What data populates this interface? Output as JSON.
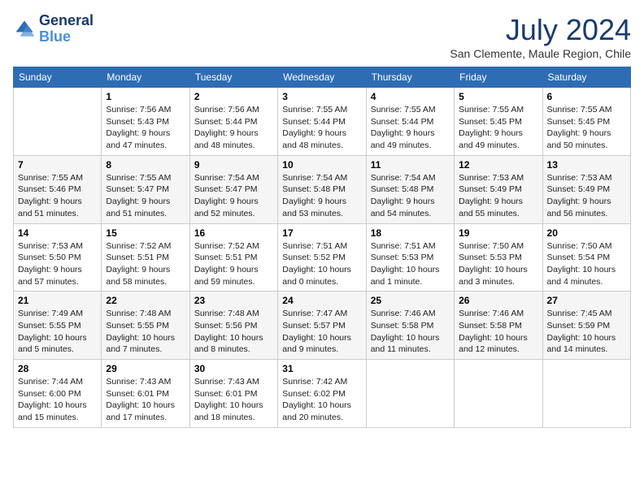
{
  "logo": {
    "line1": "General",
    "line2": "Blue"
  },
  "title": "July 2024",
  "subtitle": "San Clemente, Maule Region, Chile",
  "headers": [
    "Sunday",
    "Monday",
    "Tuesday",
    "Wednesday",
    "Thursday",
    "Friday",
    "Saturday"
  ],
  "weeks": [
    [
      {
        "day": "",
        "info": ""
      },
      {
        "day": "1",
        "info": "Sunrise: 7:56 AM\nSunset: 5:43 PM\nDaylight: 9 hours\nand 47 minutes."
      },
      {
        "day": "2",
        "info": "Sunrise: 7:56 AM\nSunset: 5:44 PM\nDaylight: 9 hours\nand 48 minutes."
      },
      {
        "day": "3",
        "info": "Sunrise: 7:55 AM\nSunset: 5:44 PM\nDaylight: 9 hours\nand 48 minutes."
      },
      {
        "day": "4",
        "info": "Sunrise: 7:55 AM\nSunset: 5:44 PM\nDaylight: 9 hours\nand 49 minutes."
      },
      {
        "day": "5",
        "info": "Sunrise: 7:55 AM\nSunset: 5:45 PM\nDaylight: 9 hours\nand 49 minutes."
      },
      {
        "day": "6",
        "info": "Sunrise: 7:55 AM\nSunset: 5:45 PM\nDaylight: 9 hours\nand 50 minutes."
      }
    ],
    [
      {
        "day": "7",
        "info": "Sunrise: 7:55 AM\nSunset: 5:46 PM\nDaylight: 9 hours\nand 51 minutes."
      },
      {
        "day": "8",
        "info": "Sunrise: 7:55 AM\nSunset: 5:47 PM\nDaylight: 9 hours\nand 51 minutes."
      },
      {
        "day": "9",
        "info": "Sunrise: 7:54 AM\nSunset: 5:47 PM\nDaylight: 9 hours\nand 52 minutes."
      },
      {
        "day": "10",
        "info": "Sunrise: 7:54 AM\nSunset: 5:48 PM\nDaylight: 9 hours\nand 53 minutes."
      },
      {
        "day": "11",
        "info": "Sunrise: 7:54 AM\nSunset: 5:48 PM\nDaylight: 9 hours\nand 54 minutes."
      },
      {
        "day": "12",
        "info": "Sunrise: 7:53 AM\nSunset: 5:49 PM\nDaylight: 9 hours\nand 55 minutes."
      },
      {
        "day": "13",
        "info": "Sunrise: 7:53 AM\nSunset: 5:49 PM\nDaylight: 9 hours\nand 56 minutes."
      }
    ],
    [
      {
        "day": "14",
        "info": "Sunrise: 7:53 AM\nSunset: 5:50 PM\nDaylight: 9 hours\nand 57 minutes."
      },
      {
        "day": "15",
        "info": "Sunrise: 7:52 AM\nSunset: 5:51 PM\nDaylight: 9 hours\nand 58 minutes."
      },
      {
        "day": "16",
        "info": "Sunrise: 7:52 AM\nSunset: 5:51 PM\nDaylight: 9 hours\nand 59 minutes."
      },
      {
        "day": "17",
        "info": "Sunrise: 7:51 AM\nSunset: 5:52 PM\nDaylight: 10 hours\nand 0 minutes."
      },
      {
        "day": "18",
        "info": "Sunrise: 7:51 AM\nSunset: 5:53 PM\nDaylight: 10 hours\nand 1 minute."
      },
      {
        "day": "19",
        "info": "Sunrise: 7:50 AM\nSunset: 5:53 PM\nDaylight: 10 hours\nand 3 minutes."
      },
      {
        "day": "20",
        "info": "Sunrise: 7:50 AM\nSunset: 5:54 PM\nDaylight: 10 hours\nand 4 minutes."
      }
    ],
    [
      {
        "day": "21",
        "info": "Sunrise: 7:49 AM\nSunset: 5:55 PM\nDaylight: 10 hours\nand 5 minutes."
      },
      {
        "day": "22",
        "info": "Sunrise: 7:48 AM\nSunset: 5:55 PM\nDaylight: 10 hours\nand 7 minutes."
      },
      {
        "day": "23",
        "info": "Sunrise: 7:48 AM\nSunset: 5:56 PM\nDaylight: 10 hours\nand 8 minutes."
      },
      {
        "day": "24",
        "info": "Sunrise: 7:47 AM\nSunset: 5:57 PM\nDaylight: 10 hours\nand 9 minutes."
      },
      {
        "day": "25",
        "info": "Sunrise: 7:46 AM\nSunset: 5:58 PM\nDaylight: 10 hours\nand 11 minutes."
      },
      {
        "day": "26",
        "info": "Sunrise: 7:46 AM\nSunset: 5:58 PM\nDaylight: 10 hours\nand 12 minutes."
      },
      {
        "day": "27",
        "info": "Sunrise: 7:45 AM\nSunset: 5:59 PM\nDaylight: 10 hours\nand 14 minutes."
      }
    ],
    [
      {
        "day": "28",
        "info": "Sunrise: 7:44 AM\nSunset: 6:00 PM\nDaylight: 10 hours\nand 15 minutes."
      },
      {
        "day": "29",
        "info": "Sunrise: 7:43 AM\nSunset: 6:01 PM\nDaylight: 10 hours\nand 17 minutes."
      },
      {
        "day": "30",
        "info": "Sunrise: 7:43 AM\nSunset: 6:01 PM\nDaylight: 10 hours\nand 18 minutes."
      },
      {
        "day": "31",
        "info": "Sunrise: 7:42 AM\nSunset: 6:02 PM\nDaylight: 10 hours\nand 20 minutes."
      },
      {
        "day": "",
        "info": ""
      },
      {
        "day": "",
        "info": ""
      },
      {
        "day": "",
        "info": ""
      }
    ]
  ]
}
